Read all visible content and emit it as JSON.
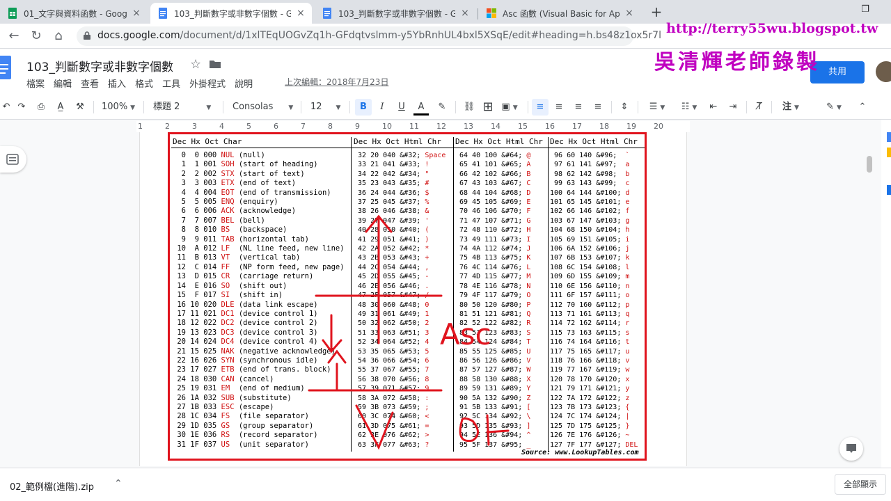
{
  "browser": {
    "tabs": [
      {
        "title": "01_文字與資料函數 - Google 雲",
        "active": false,
        "icon": "sheets-icon"
      },
      {
        "title": "103_判斷數字或非數字個數 - Go",
        "active": true,
        "icon": "docs-icon"
      },
      {
        "title": "103_判斷數字或非數字個數 - Go",
        "active": false,
        "icon": "docs-icon"
      },
      {
        "title": "Asc 函數 (Visual Basic for Applic",
        "active": false,
        "icon": "microsoft-icon"
      }
    ],
    "new_tab": "+",
    "url_host": "docs.google.com",
    "url_path": "/document/d/1xlTEqUOGvZq1h-GFdqtvslmm-y5YbRnhUL4bxl5XSqE/edit#heading=h.bs48z1ox5r7l"
  },
  "watermark": {
    "url": "http://terry55wu.blogspot.tw",
    "name": "吳清輝老師錄製"
  },
  "doc": {
    "title": "103_判斷數字或非數字個數",
    "menu": [
      "檔案",
      "編輯",
      "查看",
      "插入",
      "格式",
      "工具",
      "外掛程式",
      "說明"
    ],
    "last_edit": "上次編輯：2018年7月23日",
    "share_label": "共用"
  },
  "toolbar": {
    "zoom": "100%",
    "style": "標題 2",
    "font": "Consolas",
    "size": "12"
  },
  "ruler": {
    "ticks": [
      "1",
      "2",
      "3",
      "4",
      "5",
      "6",
      "7",
      "8",
      "9",
      "10",
      "11",
      "12",
      "13",
      "14",
      "15",
      "16",
      "17",
      "18",
      "19",
      "20"
    ]
  },
  "ascii_table": {
    "headers": [
      [
        "Dec",
        "Hx",
        "Oct",
        "Char"
      ],
      [
        "Dec",
        "Hx",
        "Oct",
        "Html",
        "Chr"
      ],
      [
        "Dec",
        "Hx",
        "Oct",
        "Html",
        "Chr"
      ],
      [
        "Dec",
        "Hx",
        "Oct",
        "Html",
        "Chr"
      ]
    ],
    "col1": [
      "  0  0 000 NUL (null)",
      "  1  1 001 SOH (start of heading)",
      "  2  2 002 STX (start of text)",
      "  3  3 003 ETX (end of text)",
      "  4  4 004 EOT (end of transmission)",
      "  5  5 005 ENQ (enquiry)",
      "  6  6 006 ACK (acknowledge)",
      "  7  7 007 BEL (bell)",
      "  8  8 010 BS  (backspace)",
      "  9  9 011 TAB (horizontal tab)",
      " 10  A 012 LF  (NL line feed, new line)",
      " 11  B 013 VT  (vertical tab)",
      " 12  C 014 FF  (NP form feed, new page)",
      " 13  D 015 CR  (carriage return)",
      " 14  E 016 SO  (shift out)",
      " 15  F 017 SI  (shift in)",
      " 16 10 020 DLE (data link escape)",
      " 17 11 021 DC1 (device control 1)",
      " 18 12 022 DC2 (device control 2)",
      " 19 13 023 DC3 (device control 3)",
      " 20 14 024 DC4 (device control 4)",
      " 21 15 025 NAK (negative acknowledge)",
      " 22 16 026 SYN (synchronous idle)",
      " 23 17 027 ETB (end of trans. block)",
      " 24 18 030 CAN (cancel)",
      " 25 19 031 EM  (end of medium)",
      " 26 1A 032 SUB (substitute)",
      " 27 1B 033 ESC (escape)",
      " 28 1C 034 FS  (file separator)",
      " 29 1D 035 GS  (group separator)",
      " 30 1E 036 RS  (record separator)",
      " 31 1F 037 US  (unit separator)"
    ],
    "col2": [
      " 32 20 040 &#32; Space",
      " 33 21 041 &#33; !",
      " 34 22 042 &#34; \"",
      " 35 23 043 &#35; #",
      " 36 24 044 &#36; $",
      " 37 25 045 &#37; %",
      " 38 26 046 &#38; &",
      " 39 27 047 &#39; '",
      " 40 28 050 &#40; (",
      " 41 29 051 &#41; )",
      " 42 2A 052 &#42; *",
      " 43 2B 053 &#43; +",
      " 44 2C 054 &#44; ,",
      " 45 2D 055 &#45; -",
      " 46 2E 056 &#46; .",
      " 47 2F 057 &#47; /",
      " 48 30 060 &#48; 0",
      " 49 31 061 &#49; 1",
      " 50 32 062 &#50; 2",
      " 51 33 063 &#51; 3",
      " 52 34 064 &#52; 4",
      " 53 35 065 &#53; 5",
      " 54 36 066 &#54; 6",
      " 55 37 067 &#55; 7",
      " 56 38 070 &#56; 8",
      " 57 39 071 &#57; 9",
      " 58 3A 072 &#58; :",
      " 59 3B 073 &#59; ;",
      " 60 3C 074 &#60; <",
      " 61 3D 075 &#61; =",
      " 62 3E 076 &#62; >",
      " 63 3F 077 &#63; ?"
    ],
    "col3": [
      " 64 40 100 &#64; @",
      " 65 41 101 &#65; A",
      " 66 42 102 &#66; B",
      " 67 43 103 &#67; C",
      " 68 44 104 &#68; D",
      " 69 45 105 &#69; E",
      " 70 46 106 &#70; F",
      " 71 47 107 &#71; G",
      " 72 48 110 &#72; H",
      " 73 49 111 &#73; I",
      " 74 4A 112 &#74; J",
      " 75 4B 113 &#75; K",
      " 76 4C 114 &#76; L",
      " 77 4D 115 &#77; M",
      " 78 4E 116 &#78; N",
      " 79 4F 117 &#79; O",
      " 80 50 120 &#80; P",
      " 81 51 121 &#81; Q",
      " 82 52 122 &#82; R",
      " 83 53 123 &#83; S",
      " 84 54 124 &#84; T",
      " 85 55 125 &#85; U",
      " 86 56 126 &#86; V",
      " 87 57 127 &#87; W",
      " 88 58 130 &#88; X",
      " 89 59 131 &#89; Y",
      " 90 5A 132 &#90; Z",
      " 91 5B 133 &#91; [",
      " 92 5C 134 &#92; \\",
      " 93 5D 135 &#93; ]",
      " 94 5E 136 &#94; ^",
      " 95 5F 137 &#95; _"
    ],
    "col4": [
      " 96 60 140 &#96;  `",
      " 97 61 141 &#97;  a",
      " 98 62 142 &#98;  b",
      " 99 63 143 &#99;  c",
      "100 64 144 &#100; d",
      "101 65 145 &#101; e",
      "102 66 146 &#102; f",
      "103 67 147 &#103; g",
      "104 68 150 &#104; h",
      "105 69 151 &#105; i",
      "106 6A 152 &#106; j",
      "107 6B 153 &#107; k",
      "108 6C 154 &#108; l",
      "109 6D 155 &#109; m",
      "110 6E 156 &#110; n",
      "111 6F 157 &#111; o",
      "112 70 160 &#112; p",
      "113 71 161 &#113; q",
      "114 72 162 &#114; r",
      "115 73 163 &#115; s",
      "116 74 164 &#116; t",
      "117 75 165 &#117; u",
      "118 76 166 &#118; v",
      "119 77 167 &#119; w",
      "120 78 170 &#120; x",
      "121 79 171 &#121; y",
      "122 7A 172 &#122; z",
      "123 7B 173 &#123; {",
      "124 7C 174 &#124; |",
      "125 7D 175 &#125; }",
      "126 7E 176 &#126; ~",
      "127 7F 177 &#127; DEL"
    ],
    "source": "Source:  www.LookupTables.com",
    "annotation_asc": "Asc",
    "annotation_or": "or"
  },
  "downloads": {
    "file": "02_範例檔(進階).zip",
    "show_all": "全部顯示"
  },
  "colors": {
    "accent": "#1a73e8",
    "annotation_red": "#e0141e",
    "watermark": "#c000c0"
  }
}
